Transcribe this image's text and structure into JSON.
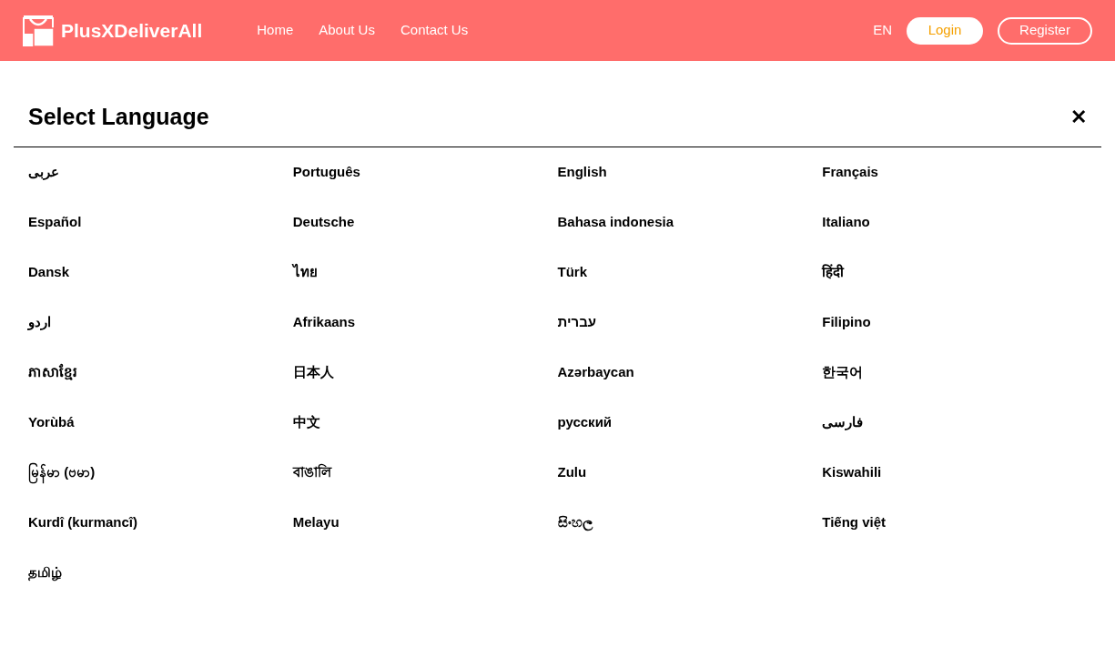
{
  "header": {
    "brand": "PlusXDeliverAll",
    "nav": [
      "Home",
      "About Us",
      "Contact Us"
    ],
    "language": "EN",
    "login": "Login",
    "register": "Register"
  },
  "dialog": {
    "title": "Select Language",
    "close": "✕",
    "languages": [
      {
        "label": "عربى"
      },
      {
        "label": "Português"
      },
      {
        "label": "English"
      },
      {
        "label": "Français"
      },
      {
        "label": "Español"
      },
      {
        "label": "Deutsche"
      },
      {
        "label": "Bahasa indonesia"
      },
      {
        "label": "Italiano"
      },
      {
        "label": "Dansk"
      },
      {
        "label": "ไทย"
      },
      {
        "label": "Türk"
      },
      {
        "label": "हिंदी"
      },
      {
        "label": "اردو"
      },
      {
        "label": "Afrikaans"
      },
      {
        "label": "עברית"
      },
      {
        "label": "Filipino"
      },
      {
        "label": "ភាសាខ្មែរ"
      },
      {
        "label": "日本人"
      },
      {
        "label": "Azərbaycan"
      },
      {
        "label": "한국어"
      },
      {
        "label": "Yorùbá"
      },
      {
        "label": "中文"
      },
      {
        "label": "русский"
      },
      {
        "label": "فارسی"
      },
      {
        "label": "မြန်မာ (ဗမာ)"
      },
      {
        "label": "বাঙালি"
      },
      {
        "label": "Zulu"
      },
      {
        "label": "Kiswahili"
      },
      {
        "label": "Kurdî (kurmancî)"
      },
      {
        "label": "Melayu"
      },
      {
        "label": "සිංහල"
      },
      {
        "label": "Tiếng việt"
      },
      {
        "label": "தமிழ்"
      }
    ]
  }
}
